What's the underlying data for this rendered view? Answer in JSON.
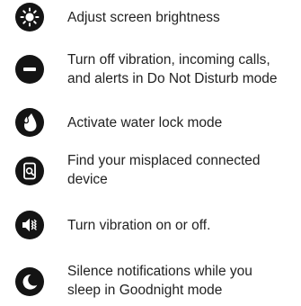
{
  "features": [
    {
      "icon": "brightness-icon",
      "text": "Adjust screen brightness"
    },
    {
      "icon": "do-not-disturb-icon",
      "text": "Turn off vibration, incoming calls,\nand alerts in Do Not Disturb mode"
    },
    {
      "icon": "water-lock-icon",
      "text": "Activate water lock mode"
    },
    {
      "icon": "find-device-icon",
      "text": "Find your misplaced connected\ndevice"
    },
    {
      "icon": "vibration-off-icon",
      "text": "Turn vibration on or off."
    },
    {
      "icon": "goodnight-mode-icon",
      "text": "Silence notifications while you\nsleep in Goodnight mode"
    }
  ]
}
